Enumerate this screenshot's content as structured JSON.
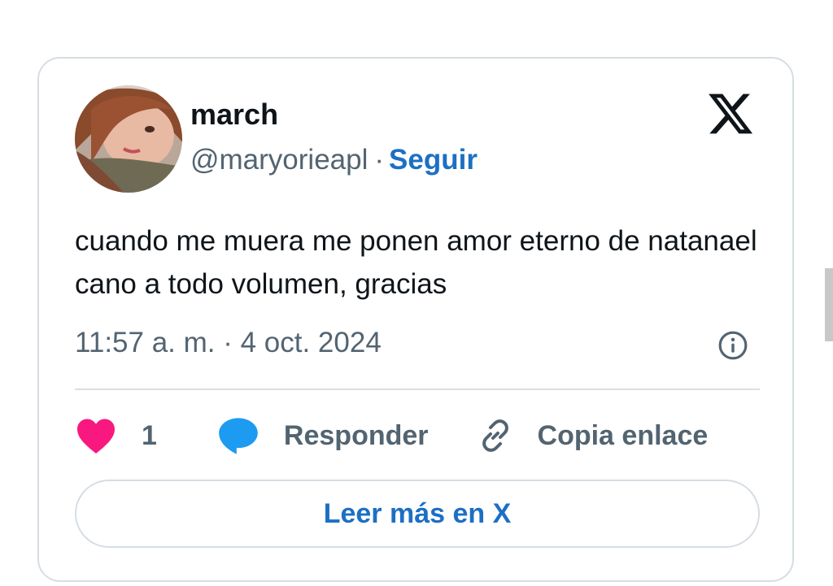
{
  "author": {
    "display_name": "march",
    "handle": "@maryorieapl",
    "separator": "·",
    "follow_label": "Seguir"
  },
  "tweet": {
    "text": "cuando me muera me ponen amor eterno de natanael cano a todo volumen, gracias",
    "timestamp": "11:57 a. m. · 4 oct. 2024"
  },
  "actions": {
    "like_count": "1",
    "reply_label": "Responder",
    "copy_label": "Copia enlace"
  },
  "read_more_label": "Leer más en X",
  "icons": {
    "logo": "x-logo-icon",
    "info": "info-icon",
    "like": "heart-icon",
    "reply": "speech-bubble-icon",
    "copy": "link-icon"
  },
  "colors": {
    "link_blue": "#1d6fc4",
    "heart_pink": "#f91880",
    "reply_blue": "#1d9bf0",
    "muted_text": "#536471",
    "primary_text": "#0f1419",
    "border": "#d6dde3"
  }
}
